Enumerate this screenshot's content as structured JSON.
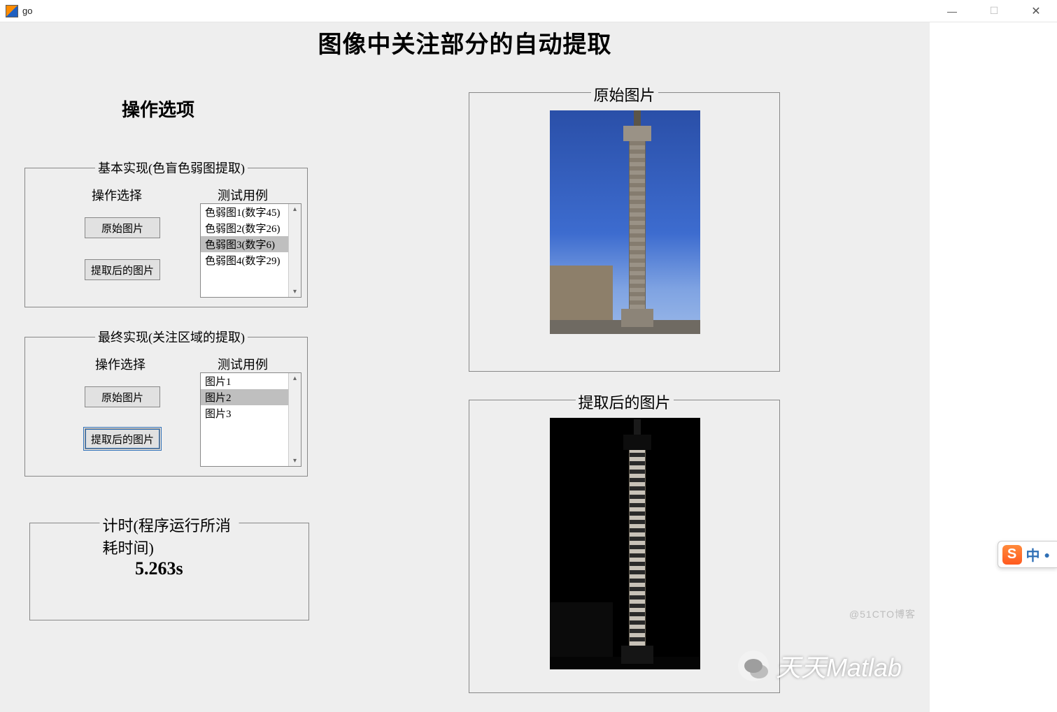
{
  "window": {
    "title": "go",
    "controls": {
      "minimize": "—",
      "maximize": "☐",
      "close": "✕"
    }
  },
  "main_title": "图像中关注部分的自动提取",
  "section_title": "操作选项",
  "panel_basic": {
    "legend": "基本实现(色盲色弱图提取)",
    "op_label": "操作选择",
    "test_label": "测试用例",
    "btn_original": "原始图片",
    "btn_extracted": "提取后的图片",
    "list": [
      "色弱图1(数字45)",
      "色弱图2(数字26)",
      "色弱图3(数字6)",
      "色弱图4(数字29)"
    ],
    "selected_index": 2
  },
  "panel_final": {
    "legend": "最终实现(关注区域的提取)",
    "op_label": "操作选择",
    "test_label": "测试用例",
    "btn_original": "原始图片",
    "btn_extracted": "提取后的图片",
    "list": [
      "图片1",
      "图片2",
      "图片3"
    ],
    "selected_index": 1
  },
  "panel_timer": {
    "legend": "计时(程序运行所消耗时间)",
    "value": "5.263s"
  },
  "panel_img_original": {
    "legend": "原始图片"
  },
  "panel_img_extracted": {
    "legend": "提取后的图片"
  },
  "watermark1": "@51CTO博客",
  "watermark2": "天天Matlab",
  "ime": {
    "s": "S",
    "lang": "中",
    "dot": "●"
  }
}
